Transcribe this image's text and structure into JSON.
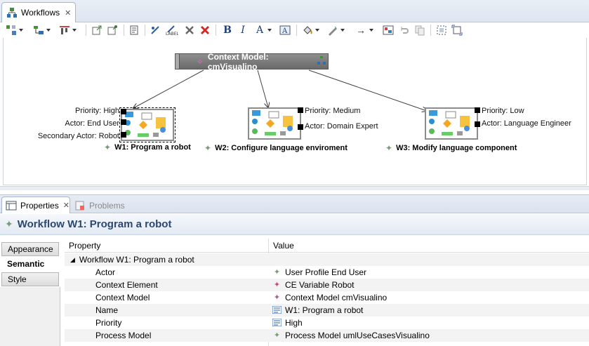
{
  "editor_tab": {
    "label": "Workflows"
  },
  "diagram": {
    "context_model": "Context Model: cmVisualino",
    "workflows": [
      {
        "title": "W1: Program a robot",
        "labels": [
          "Priority: High",
          "Actor: End User",
          "Secondary Actor: Robot"
        ]
      },
      {
        "title": "W2: Configure language enviroment",
        "labels": [
          "Priority: Medium",
          "Actor: Domain Expert"
        ]
      },
      {
        "title": "W3: Modify language component",
        "labels": [
          "Priority: Low",
          "Actor: Language Engineer"
        ]
      }
    ]
  },
  "views": {
    "properties_tab": "Properties",
    "problems_tab": "Problems"
  },
  "properties": {
    "title": "Workflow W1: Program a robot",
    "side_tabs": [
      "Appearance",
      "Semantic",
      "Style"
    ],
    "columns": [
      "Property",
      "Value"
    ],
    "group": "Workflow W1: Program a robot",
    "rows": [
      {
        "name": "Actor",
        "value": "User Profile End User",
        "icon": "element-icon"
      },
      {
        "name": "Context Element",
        "value": "CE Variable Robot",
        "icon": "context-element-icon"
      },
      {
        "name": "Context Model",
        "value": "Context Model cmVisualino",
        "icon": "context-model-icon"
      },
      {
        "name": "Name",
        "value": "W1: Program a robot",
        "icon": "text-field-icon"
      },
      {
        "name": "Priority",
        "value": "High",
        "icon": "text-field-icon"
      },
      {
        "name": "Process Model",
        "value": "Process Model umlUseCasesVisualino",
        "icon": "element-icon"
      }
    ]
  },
  "colors": {
    "header_text": "#2b4870",
    "context_box": "#7a7a7a"
  }
}
